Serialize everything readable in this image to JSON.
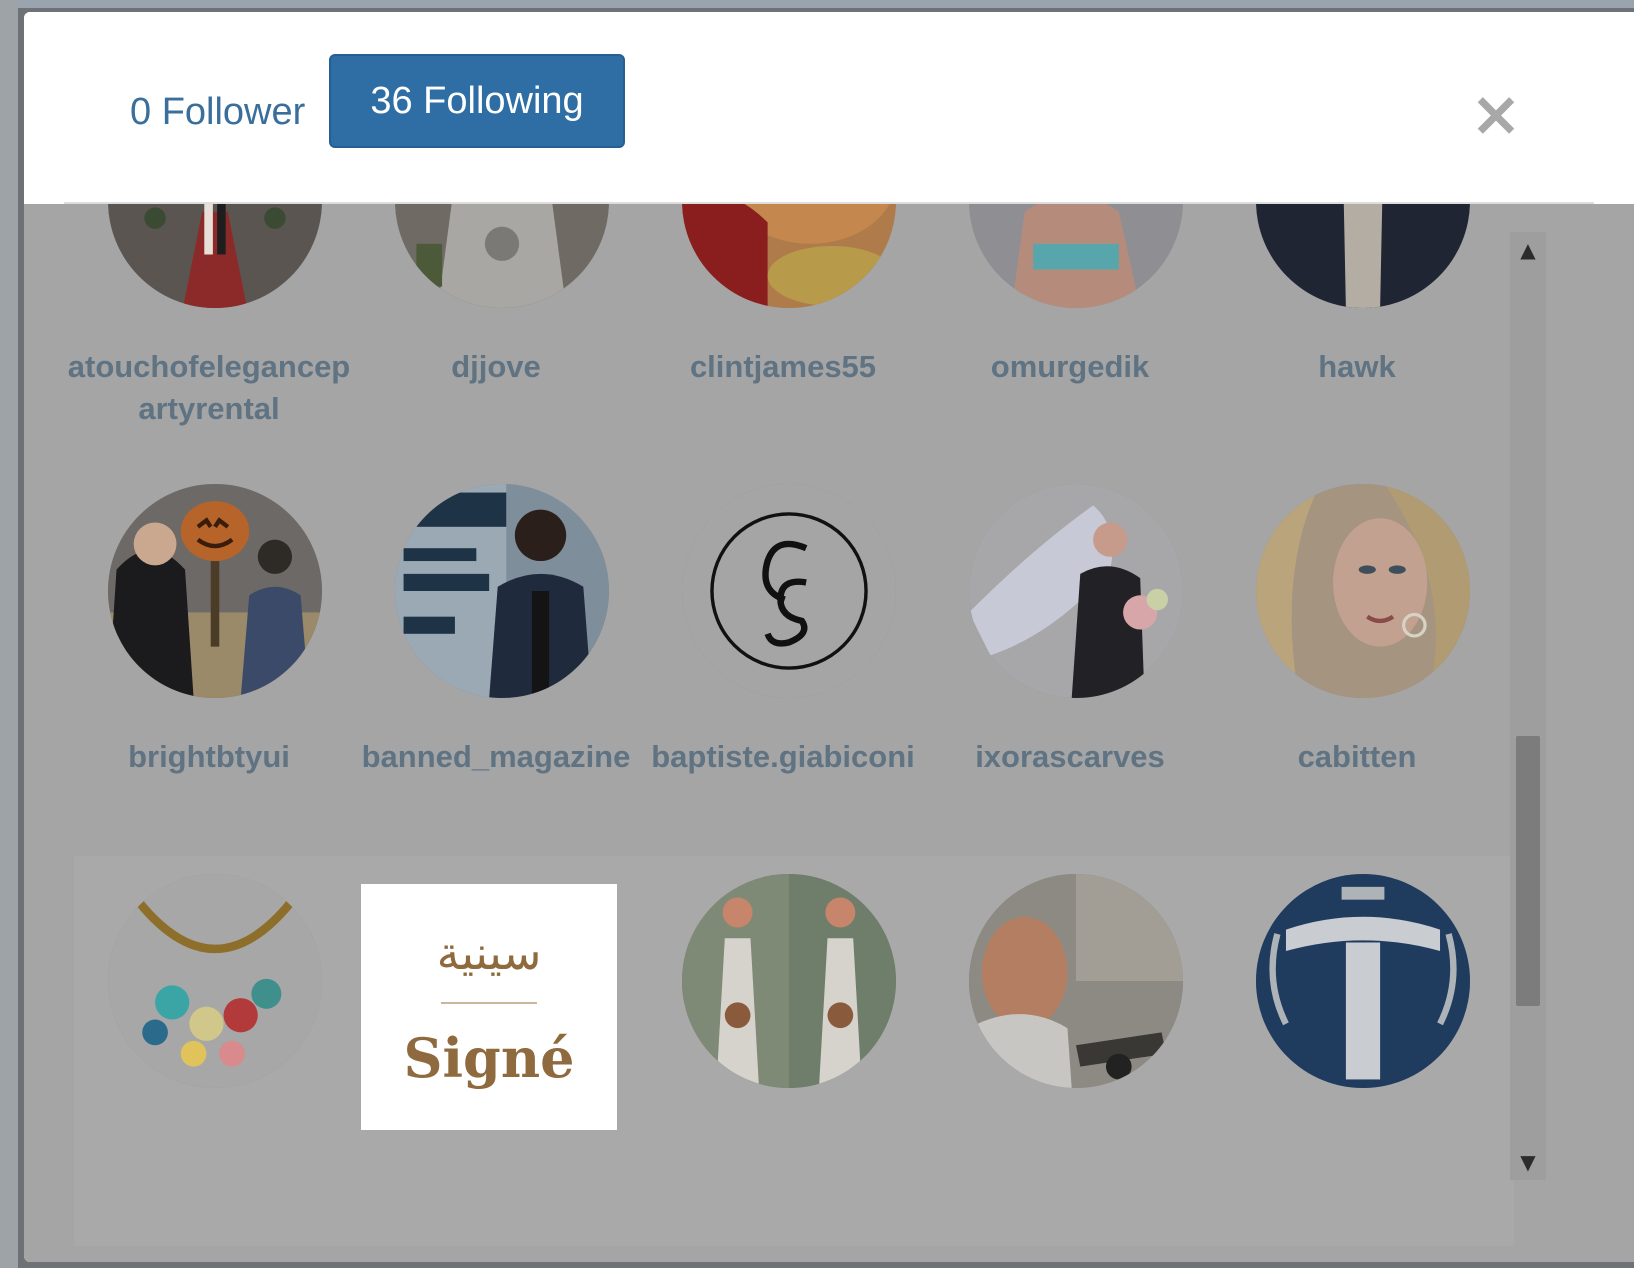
{
  "tabs": {
    "follower_label": "0 Follower",
    "following_label": "36 Following"
  },
  "close_label": "×",
  "scrollbar": {
    "up_glyph": "▲",
    "down_glyph": "▼"
  },
  "rows": [
    [
      {
        "username": "atouchofelegancepartyrental",
        "avatar_icon": "wedding-entrance-photo"
      },
      {
        "username": "djjove",
        "avatar_icon": "man-hoodie-photo"
      },
      {
        "username": "clintjames55",
        "avatar_icon": "sleeping-dog-photo"
      },
      {
        "username": "omurgedik",
        "avatar_icon": "woman-portrait-photo"
      },
      {
        "username": "hawk",
        "avatar_icon": "jacket-photo"
      }
    ],
    [
      {
        "username": "brightbtyui",
        "avatar_icon": "halloween-pumpkin-photo"
      },
      {
        "username": "banned_magazine",
        "avatar_icon": "magazine-cover-photo"
      },
      {
        "username": "baptiste.giabiconi",
        "avatar_icon": "cg-monogram-logo"
      },
      {
        "username": "ixorascarves",
        "avatar_icon": "hijab-woman-photo"
      },
      {
        "username": "cabitten",
        "avatar_icon": "blonde-woman-photo"
      }
    ],
    [
      {
        "username": "",
        "avatar_icon": "necklace-photo"
      },
      {
        "username": "",
        "avatar_icon": "signe-logo",
        "logo_arabic": "سينية",
        "logo_text": "Signé"
      },
      {
        "username": "",
        "avatar_icon": "fashion-dress-photo"
      },
      {
        "username": "",
        "avatar_icon": "man-selfie-photo"
      },
      {
        "username": "",
        "avatar_icon": "letter-t-logo"
      }
    ]
  ]
}
